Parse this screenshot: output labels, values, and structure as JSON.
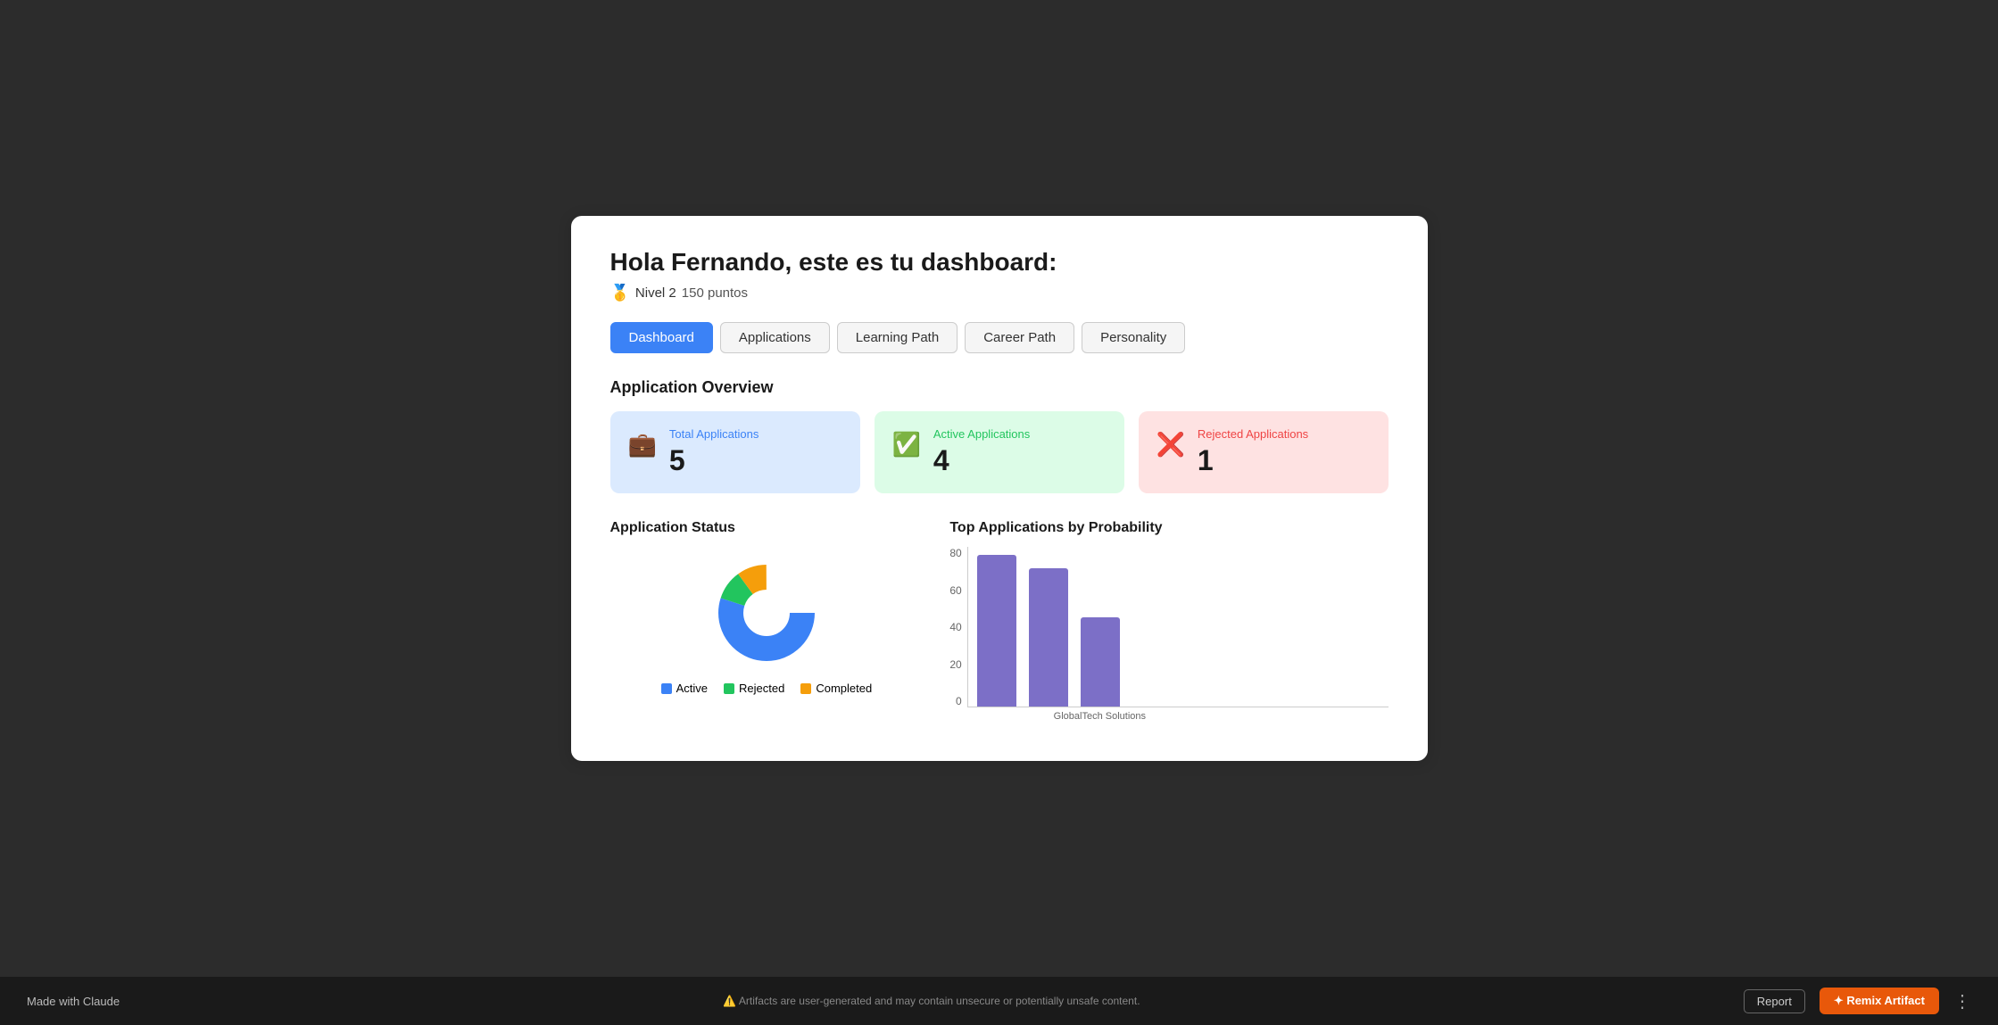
{
  "header": {
    "greeting": "Hola Fernando, este es tu dashboard:",
    "level_label": "Nivel 2",
    "points_label": "150 puntos",
    "medal_icon": "🥇"
  },
  "tabs": [
    {
      "id": "dashboard",
      "label": "Dashboard",
      "active": true
    },
    {
      "id": "applications",
      "label": "Applications",
      "active": false
    },
    {
      "id": "learning-path",
      "label": "Learning Path",
      "active": false
    },
    {
      "id": "career-path",
      "label": "Career Path",
      "active": false
    },
    {
      "id": "personality",
      "label": "Personality",
      "active": false
    }
  ],
  "overview": {
    "title": "Application Overview",
    "stats": [
      {
        "id": "total",
        "label": "Total Applications",
        "value": "5",
        "color_class": "blue",
        "icon": "💼"
      },
      {
        "id": "active",
        "label": "Active Applications",
        "value": "4",
        "color_class": "green",
        "icon": "✅"
      },
      {
        "id": "rejected",
        "label": "Rejected Applications",
        "value": "1",
        "color_class": "red",
        "icon": "❌"
      }
    ]
  },
  "application_status": {
    "title": "Application Status",
    "legend": [
      {
        "label": "Active",
        "color": "#3b82f6"
      },
      {
        "label": "Rejected",
        "color": "#22c55e"
      },
      {
        "label": "Completed",
        "color": "#f59e0b"
      }
    ]
  },
  "bar_chart": {
    "title": "Top Applications by Probability",
    "y_labels": [
      "80",
      "60",
      "40",
      "20",
      "0"
    ],
    "bars": [
      {
        "label": "GlobalTech",
        "value": 85,
        "height_pct": 100
      },
      {
        "label": "Solutions",
        "value": 78,
        "height_pct": 91
      },
      {
        "label": "",
        "value": 50,
        "height_pct": 58
      }
    ],
    "x_group_label": "GlobalTech Solutions",
    "max_value": 85
  },
  "bottom_bar": {
    "left": "Made with Claude",
    "center": "⚠️ Artifacts are user-generated and may contain unsecure or potentially unsafe content.",
    "report_label": "Report",
    "remix_label": "✦ Remix Artifact"
  }
}
